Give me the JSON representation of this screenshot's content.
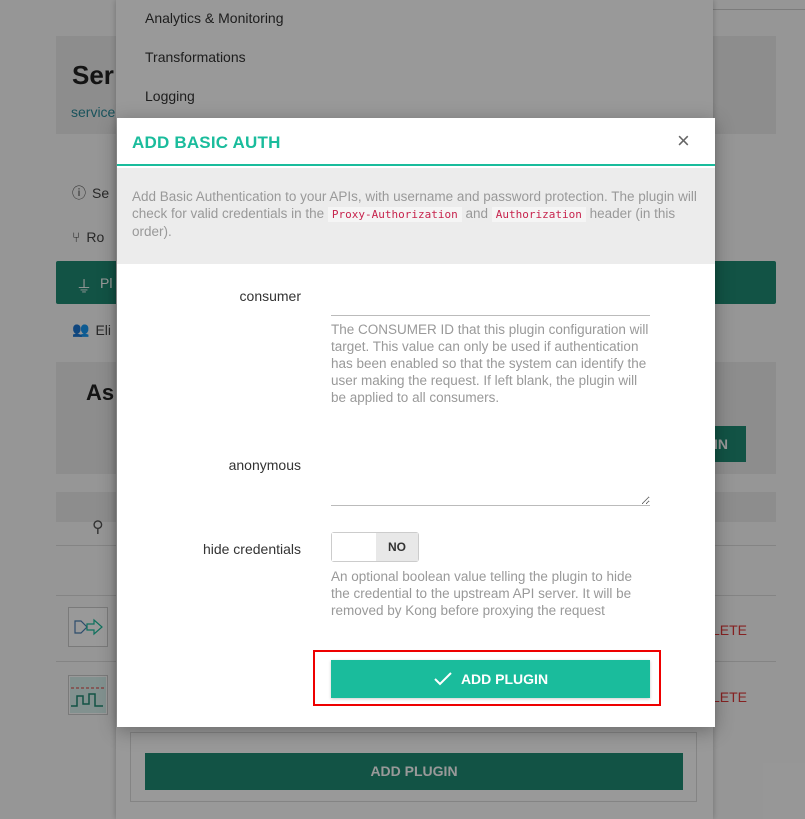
{
  "background": {
    "service_title": "Ser",
    "service_subtitle": "service",
    "sidebar": [
      {
        "label": "Se",
        "icon": "info-icon"
      },
      {
        "label": "Ro",
        "icon": "route-icon"
      },
      {
        "label": "Pl",
        "icon": "plug-icon"
      },
      {
        "label": "Eli",
        "icon": "users-icon"
      }
    ],
    "assign_title": "As",
    "assign_button": "IN",
    "delete_label": "LETE"
  },
  "dropdown": {
    "items": [
      "Analytics & Monitoring",
      "Transformations",
      "Logging"
    ],
    "add_plugin_label": "ADD PLUGIN"
  },
  "modal": {
    "title": "ADD BASIC AUTH",
    "close_glyph": "×",
    "description_pre": "Add Basic Authentication to your APIs, with username and password protection. The plugin will check for valid credentials in the ",
    "code1": "Proxy-Authorization",
    "description_mid": " and ",
    "code2": "Authorization",
    "description_post": " header (in this order).",
    "fields": {
      "consumer_label": "consumer",
      "consumer_value": "",
      "consumer_help": "The CONSUMER ID that this plugin configuration will target. This value can only be used if authentication has been enabled so that the system can identify the user making the request. If left blank, the plugin will be applied to all consumers.",
      "anonymous_label": "anonymous",
      "anonymous_value": "",
      "hide_credentials_label": "hide credentials",
      "hide_credentials_state": "NO",
      "hide_credentials_help": "An optional boolean value telling the plugin to hide the credential to the upstream API server. It will be removed by Kong before proxying the request"
    },
    "submit_label": "ADD PLUGIN",
    "accent_color": "#1abc9c"
  }
}
